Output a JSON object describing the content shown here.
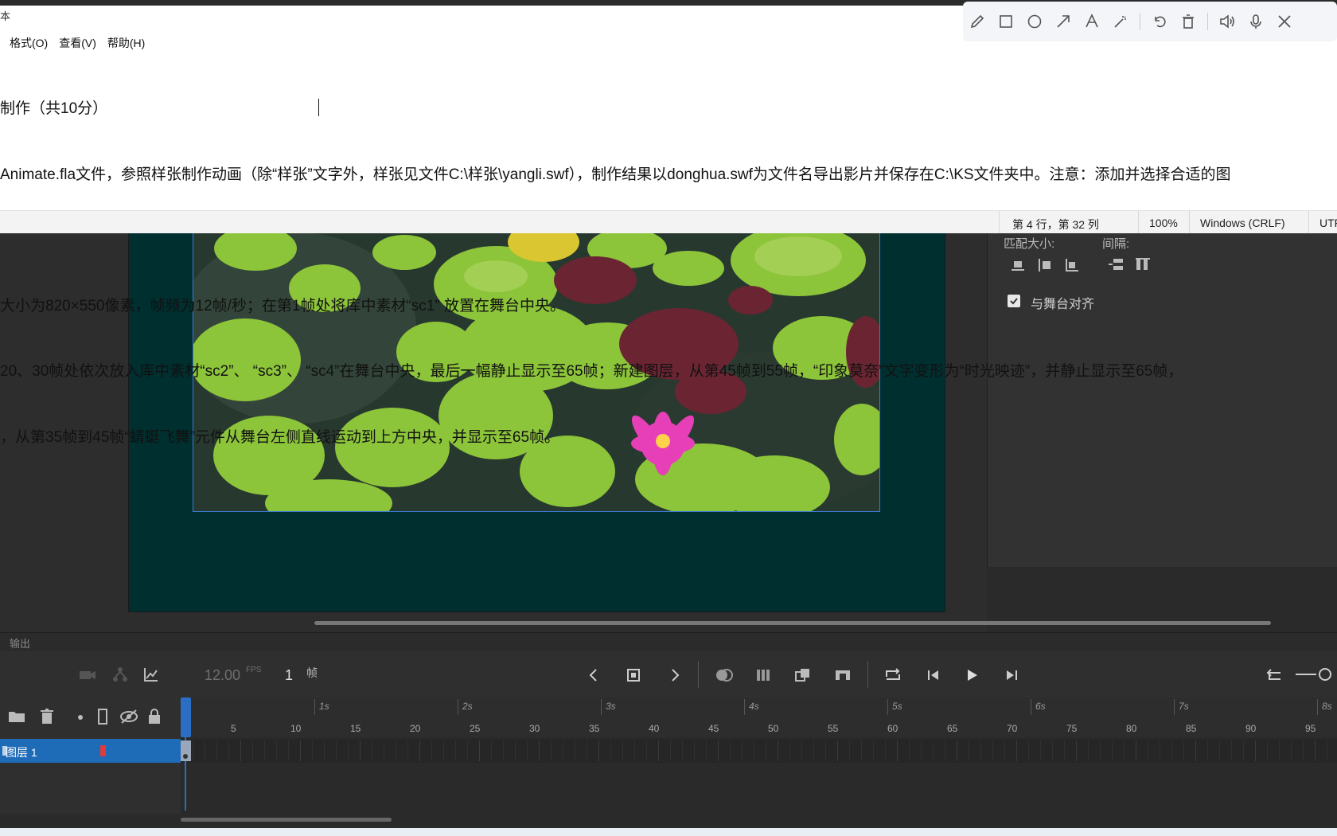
{
  "notepad": {
    "title_fragment": "本",
    "menu": [
      "格式(O)",
      "查看(V)",
      "帮助(H)"
    ],
    "lines": [
      "制作（共10分）",
      "Animate.fla文件，参照样张制作动画（除“样张”文字外，样张见文件C:\\样张\\yangli.swf），制作结果以donghua.swf为文件名导出影片并保存在C:\\KS文件夹中。注意：添加并选择合适的图",
      "",
      "大小为820×550像素，帧频为12帧/秒；在第1帧处将库中素材“sc1” 放置在舞台中央。",
      "20、30帧处依次放入库中素材“sc2”、 “sc3”、 “sc4”在舞台中央，最后一幅静止显示至65帧；新建图层，从第45帧到55帧，“印象莫奈”文字变形为“时光映迹”，并静止显示至65帧，",
      "，从第35帧到45帧“蜻蜓飞舞”元件从舞台左侧直线运动到上方中央，并显示至65帧。"
    ],
    "status": {
      "position": "第 4 行，第 32 列",
      "zoom": "100%",
      "line_ending": "Windows (CRLF)",
      "encoding": "UTF"
    }
  },
  "annotation_toolbar": {
    "icons": [
      "pencil-icon",
      "rectangle-icon",
      "circle-icon",
      "arrow-icon",
      "text-icon",
      "magic-wand-icon",
      "undo-icon",
      "trash-icon",
      "speaker-icon",
      "microphone-icon",
      "close-icon"
    ]
  },
  "right_panel": {
    "match_size_label": "匹配大小:",
    "spacing_label": "间隔:",
    "align_to_stage_label": "与舞台对齐",
    "align_to_stage_checked": true
  },
  "output_tab": "输出",
  "timeline": {
    "fps": "12.00",
    "fps_unit": "FPS",
    "current_frame": "1",
    "frame_unit": "帧",
    "seconds": [
      "1s",
      "2s",
      "3s",
      "4s",
      "5s",
      "6s",
      "7s",
      "8s"
    ],
    "frame_numbers": [
      "5",
      "10",
      "15",
      "20",
      "25",
      "30",
      "35",
      "40",
      "45",
      "50",
      "55",
      "60",
      "65",
      "70",
      "75",
      "80",
      "85",
      "90",
      "95"
    ],
    "layer_name": "图层 1",
    "layer_color": "#e03a3a"
  },
  "colors": {
    "stage_bg": "#002f30",
    "selection": "#1e6bb8",
    "photo_border": "#3b7bd6"
  }
}
